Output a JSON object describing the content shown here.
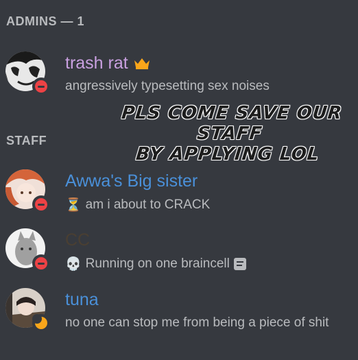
{
  "sections": {
    "admins_header": "ADMINS — 1",
    "staff_header": "STAFF"
  },
  "announcement": {
    "line1": "PLS  COME SAVE OUR STAFF",
    "line2": "BY APPLYING LOL"
  },
  "members": [
    {
      "name": "trash rat",
      "name_color": "#c9a0e0",
      "status": "dnd",
      "status_icon": "crown-icon",
      "status_text": "angressively typesetting sex noises"
    },
    {
      "name": "Awwa's Big sister",
      "name_color": "#4a90d9",
      "status": "dnd",
      "status_icon": "hourglass-icon",
      "status_emoji": "⏳",
      "status_text": "am i about to CRACK"
    },
    {
      "name": "CC",
      "name_color": "#4a3f32",
      "status": "dnd",
      "status_icon": "skull-icon",
      "status_emoji": "💀",
      "status_text": "Running on one braincell"
    },
    {
      "name": "tuna",
      "name_color": "#4a90d9",
      "status": "idle",
      "status_text": "no one can stop me from being a piece of shit"
    }
  ],
  "colors": {
    "background": "#36393f",
    "dnd": "#ed4245",
    "idle": "#faa61a",
    "crown": "#faa61a"
  }
}
